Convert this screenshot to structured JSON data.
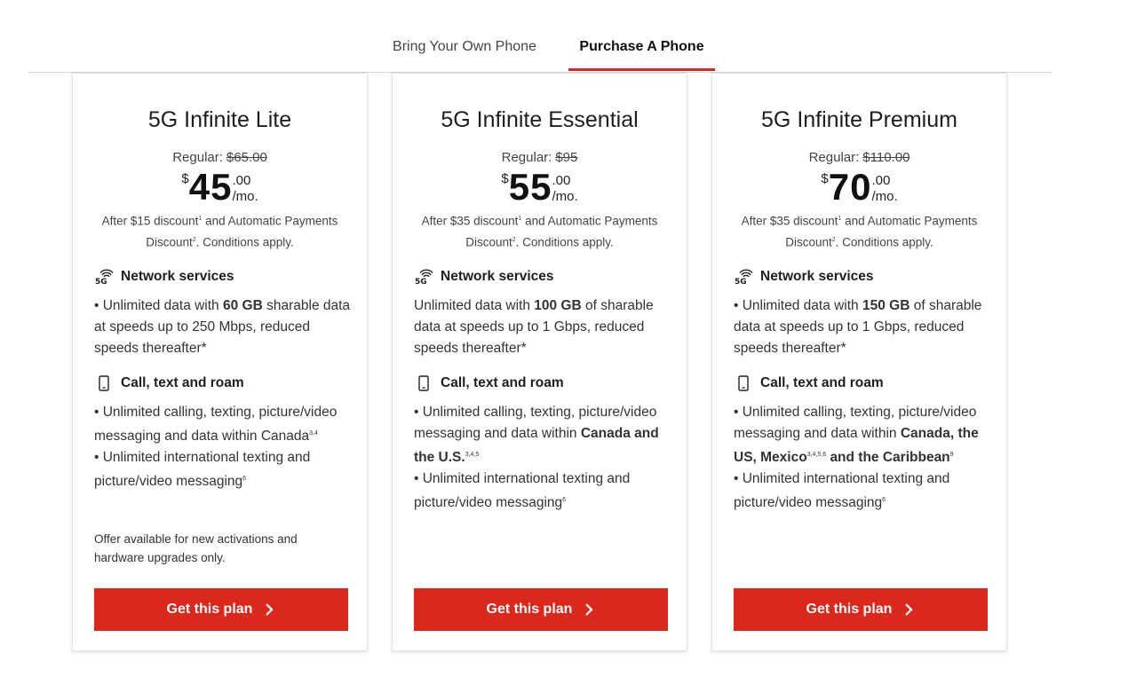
{
  "tabs": [
    {
      "label": "Bring Your Own Phone",
      "active": false
    },
    {
      "label": "Purchase A Phone",
      "active": true
    }
  ],
  "icons": {
    "network": "5g-signal-icon",
    "call": "phone-icon",
    "button_arrow": "chevron-right-icon"
  },
  "colors": {
    "accent": "#da291c",
    "tab_underline": "#d8271e"
  },
  "plans": [
    {
      "title": "5G Infinite Lite",
      "regular_label": "Regular:",
      "regular_price": "$65.00",
      "currency": "$",
      "price": "45",
      "cents": ".00",
      "period": "/mo.",
      "disclaimer_a": "After $15 discount",
      "disclaimer_sup1": "1",
      "disclaimer_b": " and Automatic Payments Discount",
      "disclaimer_sup2": "2",
      "disclaimer_c": ". Conditions apply.",
      "network_heading": "Network services",
      "data_pre": "• Unlimited data with ",
      "data_amount": "60 GB",
      "data_post": " sharable data at speeds up to 250 Mbps, reduced speeds thereafter*",
      "call_heading": "Call, text and roam",
      "calling_pre": "• Unlimited calling, texting, picture/video messaging and data within Canada",
      "calling_bold": "",
      "calling_sup": "3,4",
      "calling_post": "",
      "calling_bold2": "",
      "calling_sup2": "",
      "intl": "• Unlimited international texting and picture/video messaging",
      "intl_sup": "6",
      "offer": "Offer available for new activations and hardware upgrades only.",
      "button": "Get this plan"
    },
    {
      "title": "5G Infinite Essential",
      "regular_label": "Regular:",
      "regular_price": "$95",
      "currency": "$",
      "price": "55",
      "cents": ".00",
      "period": "/mo.",
      "disclaimer_a": "After $35 discount",
      "disclaimer_sup1": "1",
      "disclaimer_b": " and Automatic Payments Discount",
      "disclaimer_sup2": "2",
      "disclaimer_c": ". Conditions apply.",
      "network_heading": "Network services",
      "data_pre": "Unlimited data with ",
      "data_amount": "100 GB",
      "data_post": " of sharable data at speeds up to 1 Gbps, reduced speeds thereafter*",
      "call_heading": "Call, text and roam",
      "calling_pre": "• Unlimited calling, texting, picture/video messaging and data within ",
      "calling_bold": "Canada and the U.S.",
      "calling_sup": "3,4,5",
      "calling_post": "",
      "calling_bold2": "",
      "calling_sup2": "",
      "intl": "• Unlimited international texting and picture/video messaging",
      "intl_sup": "6",
      "offer": "",
      "button": "Get this plan"
    },
    {
      "title": "5G Infinite Premium",
      "regular_label": "Regular:",
      "regular_price": "$110.00",
      "currency": "$",
      "price": "70",
      "cents": ".00",
      "period": "/mo.",
      "disclaimer_a": "After $35 discount",
      "disclaimer_sup1": "1",
      "disclaimer_b": " and Automatic Payments Discount",
      "disclaimer_sup2": "2",
      "disclaimer_c": ". Conditions apply.",
      "network_heading": "Network services",
      "data_pre": "• Unlimited data with ",
      "data_amount": "150 GB",
      "data_post": " of sharable data at speeds up to 1 Gbps, reduced speeds thereafter*",
      "call_heading": "Call, text and roam",
      "calling_pre": "• Unlimited calling, texting, picture/video messaging and data within ",
      "calling_bold": "Canada, the US, Mexico",
      "calling_sup": "3,4,5,6",
      "calling_post": " ",
      "calling_bold2": "and the Caribbean",
      "calling_sup2": "9",
      "intl": "• Unlimited international texting and picture/video messaging",
      "intl_sup": "6",
      "offer": "",
      "button": "Get this plan"
    }
  ]
}
